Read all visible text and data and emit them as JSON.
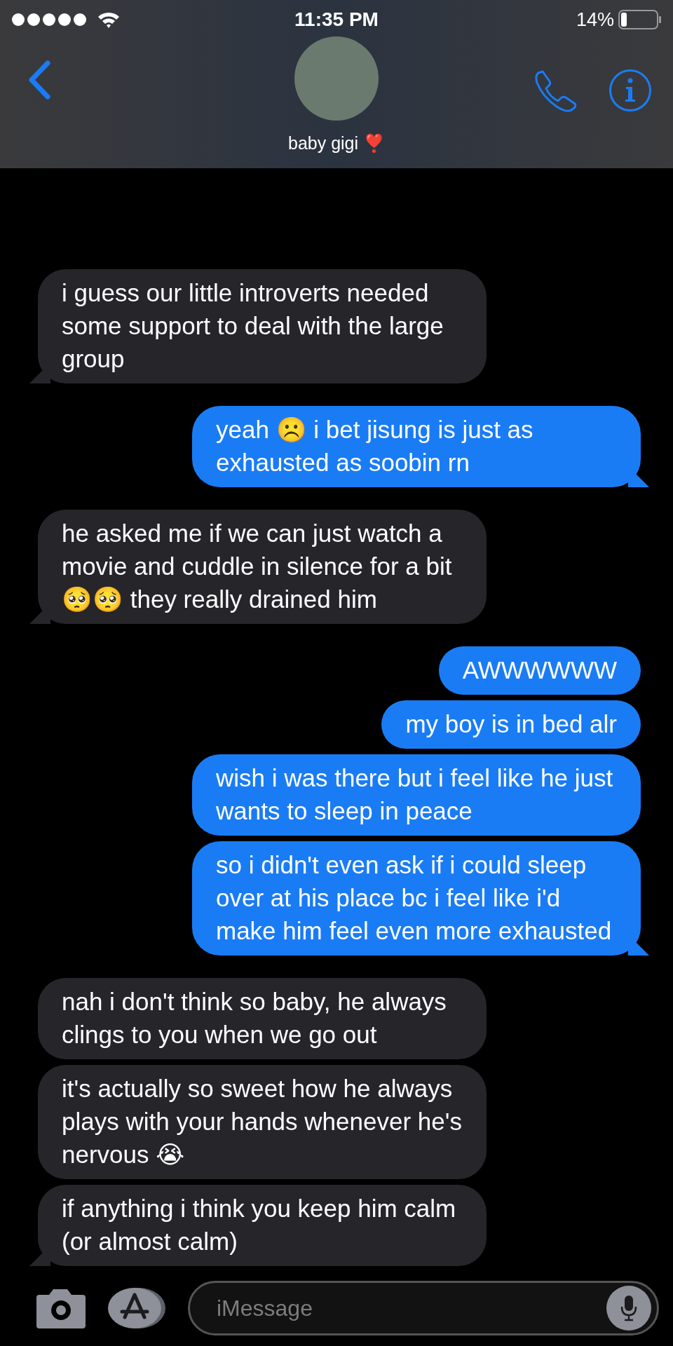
{
  "status_bar": {
    "time": "11:35 PM",
    "battery": "14%"
  },
  "header": {
    "contact_name": "baby gigi ❣️"
  },
  "messages": [
    {
      "kind": "incoming",
      "text": "i guess our little introverts needed some support to deal with the large group",
      "tail": true
    },
    {
      "kind": "outgoing",
      "text": "yeah ☹️ i bet jisung is just as exhausted as soobin rn",
      "tail": true
    },
    {
      "kind": "incoming",
      "text": "he asked me if we can just watch a movie and cuddle in silence for a bit 🥺🥺 they really drained him",
      "tail": true
    },
    {
      "kind": "outgoing",
      "text": "AWWWWWW",
      "tail": false
    },
    {
      "kind": "outgoing",
      "text": "my boy is in bed alr",
      "tail": false
    },
    {
      "kind": "outgoing",
      "text": "wish i was there but i feel like he just wants to sleep in peace",
      "tail": false
    },
    {
      "kind": "outgoing",
      "text": "so i didn't even ask if i could sleep over at his place bc i feel like i'd make him feel even more exhausted",
      "tail": true
    },
    {
      "kind": "incoming",
      "text": "nah i don't think so baby, he always clings to you when we go out",
      "tail": false
    },
    {
      "kind": "incoming",
      "text": "it's actually so sweet how he always plays with your hands whenever he's nervous 😭",
      "tail": false
    },
    {
      "kind": "incoming",
      "text": "if anything i think you keep him calm (or almost calm)",
      "tail": true
    }
  ],
  "composer": {
    "placeholder": "iMessage"
  }
}
